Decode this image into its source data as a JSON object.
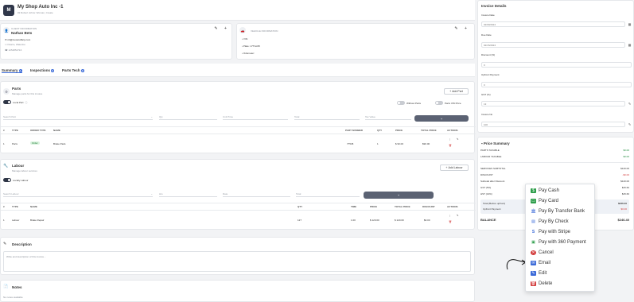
{
  "header": {
    "logo_letter": "M",
    "title": "My Shop Auto Inc -1",
    "subtitle": "#2 Robert Johns: Woman, Create"
  },
  "client_card": {
    "section_label": "CLIENT INFORMATION",
    "name": "Nathan Bets",
    "email": "nb@mocaroffarp.com",
    "location": "Ontario, Waterloo",
    "phone": "1254852716"
  },
  "vehicle_card": {
    "section_label": "VEHICLE INFORMATION",
    "vin": "VIN:",
    "plate": "Plate: 17TGJ45",
    "odometer": "Odometer:"
  },
  "tabs": [
    {
      "label": "Summary",
      "count": "1"
    },
    {
      "label": "Inspections",
      "count": "0"
    },
    {
      "label": "Parts Tech",
      "count": "0"
    }
  ],
  "parts": {
    "title": "Parts",
    "subtitle": "Manage parts for this invoice",
    "local_parts_label": "Local Part",
    "add_button": "Add Part",
    "without_parts_label": "Without Parts",
    "parts_vin_label": "Parts VIN Price",
    "filters": [
      "Search Part",
      "Qty",
      "Unit Price",
      "Total",
      "Tax Value"
    ],
    "columns": [
      "#",
      "TYPE",
      "ORDER TYPE",
      "NAME",
      "PART NUMBER",
      "QTY",
      "PRICE",
      "TOTAL PRICE",
      "ACTIONS"
    ],
    "rows": [
      {
        "num": "1",
        "type": "Parts",
        "order_type": "Order",
        "name": "Brake Pads",
        "part_number": "77545",
        "qty": "1",
        "price": "$ 90.00",
        "total": "$90.00"
      }
    ]
  },
  "labour": {
    "title": "Labour",
    "subtitle": "Manage labour services",
    "toggle_label": "Locally Labour",
    "add_button": "Add Labour",
    "filters": [
      "Search Labour",
      "Hrs",
      "Rate",
      "Total"
    ],
    "columns": [
      "#",
      "TYPE",
      "NAME",
      "QTY",
      "TIME",
      "PRICE",
      "TOTAL PRICE",
      "DISCOUNT",
      "ACTIONS"
    ],
    "rows": [
      {
        "num": "1",
        "type": "Labour",
        "name": "Brake Repair",
        "qty": "127",
        "time": "1.00",
        "price": "$ 120.00",
        "total": "$ 120.00",
        "discount": "$0.00"
      }
    ]
  },
  "description": {
    "title": "Description",
    "placeholder": "Write and description of this invoice..."
  },
  "notes": {
    "title": "Notes",
    "placeholder": "No notes available"
  },
  "invoice_details": {
    "title": "Invoice Details",
    "invoice_date_label": "Invoice Date",
    "invoice_date": "02/09/2024",
    "due_date_label": "Due Date",
    "due_date": "02/15/2024",
    "discount_label": "Discount (%)",
    "discount": "0",
    "upfront_label": "Upfront Payment",
    "upfront": "0",
    "gst_label": "GST (%)",
    "gst": "13",
    "invoice_no_label": "Invoice No",
    "invoice_no": "100"
  },
  "price_summary": {
    "title": "Price Summary",
    "rows": [
      {
        "label": "PARTS TAXABLE",
        "value": "$0.00",
        "color": "#1f8a3a"
      },
      {
        "label": "LABOUR TAXABLE",
        "value": "$0.00",
        "color": "#1f8a3a"
      },
      {
        "label": "SERVICES SUBTOTAL",
        "value": "$120.00",
        "color": "#333333"
      },
      {
        "label": "DISCOUNT",
        "value": "-$0.00",
        "color": "#d23b3b"
      },
      {
        "label": "Subtotal after Discount",
        "value": "$120.00",
        "color": "#333333"
      },
      {
        "label": "GST (5%)",
        "value": "$15.60",
        "color": "#333333"
      },
      {
        "label": "HST (13%)",
        "value": "$15.60",
        "color": "#333333"
      }
    ],
    "total_label": "Total (Before upfront)",
    "total_value": "$246.40",
    "upfront_label": "Upfront Payment",
    "upfront_value": "$0.00",
    "balance_label": "BALANCE",
    "balance_value": "$246.40"
  },
  "context_menu": {
    "items": [
      {
        "label": "Pay Cash",
        "icon": "cash-icon",
        "color": "#2e9e4b"
      },
      {
        "label": "Pay Card",
        "icon": "card-icon",
        "color": "#2e9e4b"
      },
      {
        "label": "Pay By Transfer Bank",
        "icon": "bank-icon",
        "color": "#3b6ad8"
      },
      {
        "label": "Pay By Check",
        "icon": "check-icon",
        "color": "#3b6ad8"
      },
      {
        "label": "Pay with Stripe",
        "icon": "stripe-icon",
        "color": "#3b6ad8"
      },
      {
        "label": "Pay with 360 Payment",
        "icon": "payment-icon",
        "color": "#2e9e4b"
      },
      {
        "label": "Cancel",
        "icon": "cancel-icon",
        "color": "#d23b3b"
      },
      {
        "label": "Email",
        "icon": "email-icon",
        "color": "#3b6ad8"
      },
      {
        "label": "Edit",
        "icon": "edit-icon",
        "color": "#3b6ad8"
      },
      {
        "label": "Delete",
        "icon": "delete-icon",
        "color": "#d23b3b"
      }
    ]
  }
}
